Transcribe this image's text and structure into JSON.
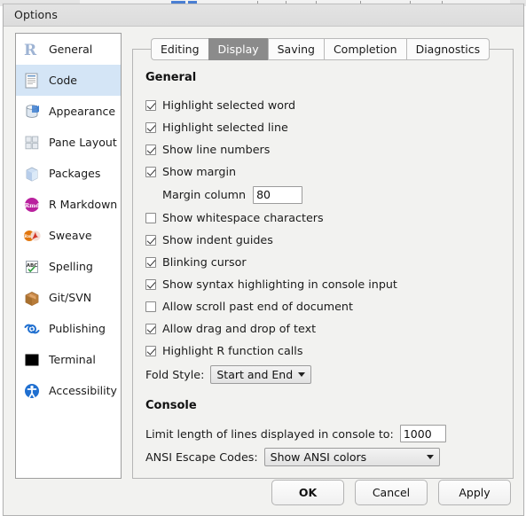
{
  "window": {
    "title": "Options"
  },
  "sidebar": {
    "items": [
      {
        "label": "General",
        "icon": "r-logo-icon",
        "selected": false
      },
      {
        "label": "Code",
        "icon": "document-icon",
        "selected": true
      },
      {
        "label": "Appearance",
        "icon": "paint-bucket-icon",
        "selected": false
      },
      {
        "label": "Pane Layout",
        "icon": "grid-panes-icon",
        "selected": false
      },
      {
        "label": "Packages",
        "icon": "box-cube-icon",
        "selected": false
      },
      {
        "label": "R Markdown",
        "icon": "rmd-badge-icon",
        "selected": false
      },
      {
        "label": "Sweave",
        "icon": "sweave-pdf-icon",
        "selected": false
      },
      {
        "label": "Spelling",
        "icon": "abc-check-icon",
        "selected": false
      },
      {
        "label": "Git/SVN",
        "icon": "package-box-icon",
        "selected": false
      },
      {
        "label": "Publishing",
        "icon": "publish-icon",
        "selected": false
      },
      {
        "label": "Terminal",
        "icon": "terminal-icon",
        "selected": false
      },
      {
        "label": "Accessibility",
        "icon": "accessibility-icon",
        "selected": false
      }
    ]
  },
  "tabs": [
    {
      "label": "Editing",
      "active": false
    },
    {
      "label": "Display",
      "active": true
    },
    {
      "label": "Saving",
      "active": false
    },
    {
      "label": "Completion",
      "active": false
    },
    {
      "label": "Diagnostics",
      "active": false
    }
  ],
  "general": {
    "heading": "General",
    "checkboxes": [
      {
        "label": "Highlight selected word",
        "checked": true
      },
      {
        "label": "Highlight selected line",
        "checked": true
      },
      {
        "label": "Show line numbers",
        "checked": true
      },
      {
        "label": "Show margin",
        "checked": true
      }
    ],
    "margin_column_label": "Margin column",
    "margin_column_value": "80",
    "checkboxes2": [
      {
        "label": "Show whitespace characters",
        "checked": false
      },
      {
        "label": "Show indent guides",
        "checked": true
      },
      {
        "label": "Blinking cursor",
        "checked": true
      },
      {
        "label": "Show syntax highlighting in console input",
        "checked": true
      },
      {
        "label": "Allow scroll past end of document",
        "checked": false
      },
      {
        "label": "Allow drag and drop of text",
        "checked": true
      },
      {
        "label": "Highlight R function calls",
        "checked": true
      }
    ],
    "fold_style_label": "Fold Style:",
    "fold_style_value": "Start and End"
  },
  "console": {
    "heading": "Console",
    "limit_label": "Limit length of lines displayed in console to:",
    "limit_value": "1000",
    "ansi_label": "ANSI Escape Codes:",
    "ansi_value": "Show ANSI colors"
  },
  "footer": {
    "ok_label": "OK",
    "cancel_label": "Cancel",
    "apply_label": "Apply"
  },
  "colors": {
    "selection_blue": "#d4e5f6",
    "active_tab_gray": "#8b8b8b",
    "dialog_bg": "#f2f2f0",
    "titlebar_bg": "#dcdcdc"
  }
}
